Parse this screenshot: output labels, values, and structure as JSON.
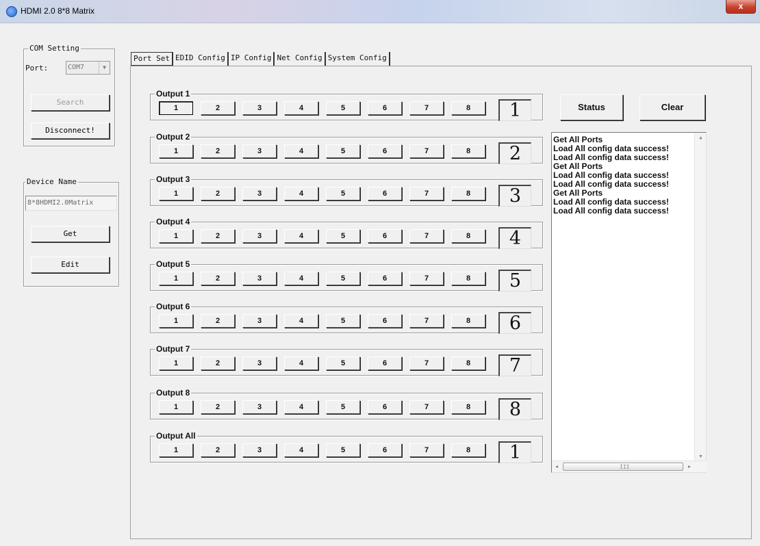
{
  "window": {
    "title": "HDMI 2.0 8*8 Matrix",
    "close_label": "x"
  },
  "com_setting": {
    "legend": "COM Setting",
    "port_label": "Port:",
    "port_value": "COM7",
    "search_label": "Search",
    "disconnect_label": "Disconnect!"
  },
  "device": {
    "legend": "Device Name",
    "name_value": "8*8HDMI2.0Matrix",
    "get_label": "Get",
    "edit_label": "Edit"
  },
  "tabs": [
    {
      "label": "Port Set",
      "active": true
    },
    {
      "label": "EDID Config",
      "active": false
    },
    {
      "label": "IP Config",
      "active": false
    },
    {
      "label": "Net Config",
      "active": false
    },
    {
      "label": "System Config",
      "active": false
    }
  ],
  "outputs": [
    {
      "label": "Output 1",
      "inputs": [
        "1",
        "2",
        "3",
        "4",
        "5",
        "6",
        "7",
        "8"
      ],
      "selected": "1"
    },
    {
      "label": "Output 2",
      "inputs": [
        "1",
        "2",
        "3",
        "4",
        "5",
        "6",
        "7",
        "8"
      ],
      "selected": "2"
    },
    {
      "label": "Output 3",
      "inputs": [
        "1",
        "2",
        "3",
        "4",
        "5",
        "6",
        "7",
        "8"
      ],
      "selected": "3"
    },
    {
      "label": "Output 4",
      "inputs": [
        "1",
        "2",
        "3",
        "4",
        "5",
        "6",
        "7",
        "8"
      ],
      "selected": "4"
    },
    {
      "label": "Output 5",
      "inputs": [
        "1",
        "2",
        "3",
        "4",
        "5",
        "6",
        "7",
        "8"
      ],
      "selected": "5"
    },
    {
      "label": "Output 6",
      "inputs": [
        "1",
        "2",
        "3",
        "4",
        "5",
        "6",
        "7",
        "8"
      ],
      "selected": "6"
    },
    {
      "label": "Output 7",
      "inputs": [
        "1",
        "2",
        "3",
        "4",
        "5",
        "6",
        "7",
        "8"
      ],
      "selected": "7"
    },
    {
      "label": "Output 8",
      "inputs": [
        "1",
        "2",
        "3",
        "4",
        "5",
        "6",
        "7",
        "8"
      ],
      "selected": "8"
    },
    {
      "label": "Output All",
      "inputs": [
        "1",
        "2",
        "3",
        "4",
        "5",
        "6",
        "7",
        "8"
      ],
      "selected": "1"
    }
  ],
  "actions": {
    "status_label": "Status",
    "clear_label": "Clear"
  },
  "log": [
    "Get All Ports",
    "Load All config data success!",
    "Load All config data success!",
    "Get All Ports",
    "Load All config data success!",
    "Load All config data success!",
    "Get All Ports",
    "Load All config data success!",
    "Load All config data success!"
  ],
  "scrollbar": {
    "thumb_grip": "III"
  }
}
